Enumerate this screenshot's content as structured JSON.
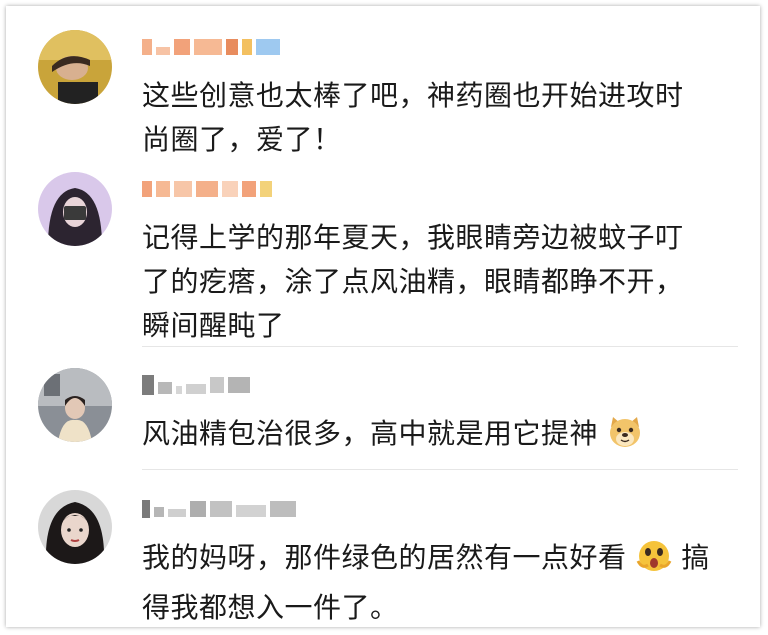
{
  "comments": [
    {
      "avatar": "avatar-girl-yellow",
      "text_lines": [
        "这些创意也太棒了吧，神药圈也开始进攻时",
        "尚圈了，爱了！"
      ],
      "emoji": null
    },
    {
      "avatar": "avatar-girl-purple",
      "text_lines": [
        "记得上学的那年夏天，我眼睛旁边被蚊子叮",
        "了的疙瘩，涂了点风油精，眼睛都睁不开，",
        "瞬间醒盹了"
      ],
      "emoji": null
    },
    {
      "avatar": "avatar-girl-photo",
      "text_lines": [
        "风油精包治很多，高中就是用它提神"
      ],
      "emoji": "doge-icon"
    },
    {
      "avatar": "avatar-girl-dark",
      "text_lines": [
        "我的妈呀，那件绿色的居然有一点好看",
        "得我都想入一件了。"
      ],
      "emoji": "surprised-face-icon",
      "line1_suffix": "搞"
    }
  ],
  "colors": {
    "text": "#1a1a1a",
    "divider": "#e6e6e6",
    "pixel_orange": "#f2a27a",
    "pixel_gray": "#c8c8c8",
    "pixel_blue": "#9ec9f0"
  }
}
